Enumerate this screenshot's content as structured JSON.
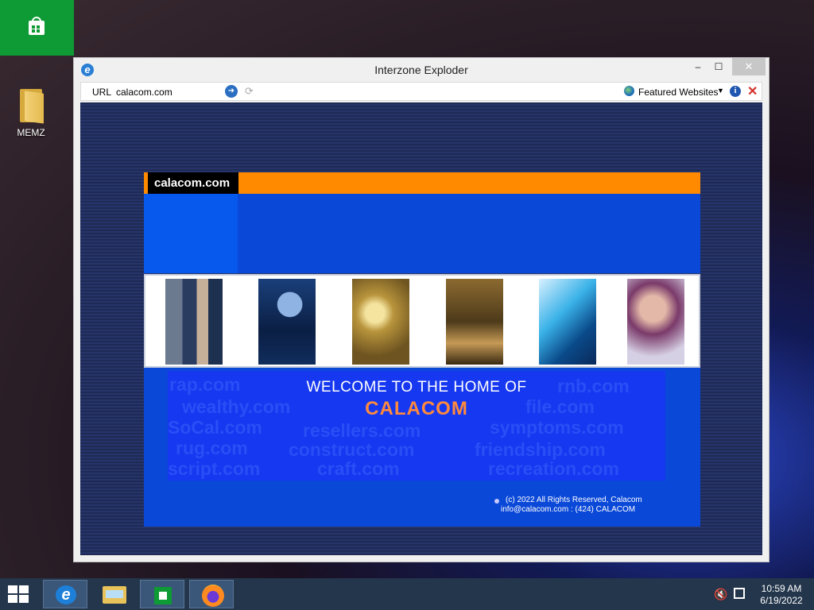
{
  "desktop": {
    "icons": [
      {
        "label": "MEMZ",
        "icon": "folder-icon"
      }
    ]
  },
  "window": {
    "title": "Interzone Exploder",
    "buttons": {
      "minimize": "–",
      "maximize": "☐",
      "close": "✕"
    }
  },
  "toolbar": {
    "url_label": "URL",
    "url_value": "calacom.com",
    "featured_label": "Featured Websites",
    "go_glyph": "➜",
    "refresh_glyph": "⟳",
    "info_glyph": "i",
    "stop_glyph": "✕"
  },
  "site": {
    "logo_text": "calacom.com",
    "welcome_line": "WELCOME TO THE HOME OF",
    "brand_name": "CALACOM",
    "background_domains": [
      "rap.com",
      "rnb.com",
      "wealthy.com",
      "file.com",
      "SoCal.com",
      "resellers.com",
      "symptoms.com",
      "rug.com",
      "construct.com",
      "friendship.com",
      "script.com",
      "craft.com",
      "recreation.com"
    ],
    "copyright": "(c) 2022 All Rights Reserved, Calacom",
    "contact": "info@calacom.com : (424) CALACOM",
    "colors": {
      "orange": "#ff8a00",
      "blue": "#0a48d8",
      "brand_text": "#ff8a3d"
    }
  },
  "taskbar": {
    "apps": [
      "internet-explorer",
      "file-explorer",
      "store",
      "firefox"
    ],
    "time": "10:59 AM",
    "date": "6/19/2022"
  }
}
